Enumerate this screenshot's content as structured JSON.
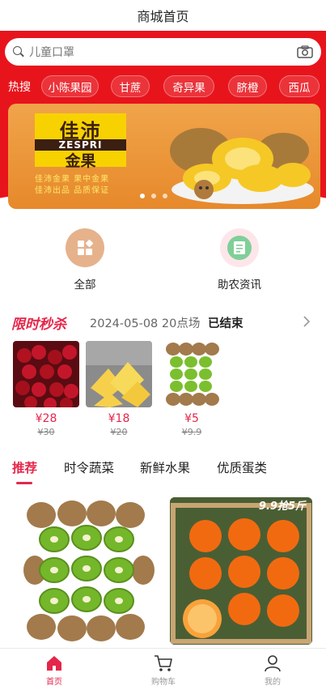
{
  "header": {
    "title": "商城首页"
  },
  "search": {
    "placeholder": "儿童口罩"
  },
  "hot_search": {
    "label": "热搜",
    "tags": [
      "小陈果园",
      "甘蔗",
      "奇异果",
      "脐橙",
      "西瓜"
    ]
  },
  "banner": {
    "logo_line1": "佳沛",
    "logo_line2": "ZESPRI",
    "logo_line3": "金果",
    "caption1": "佳沛金果 果中金果",
    "caption2": "佳沛出品 品质保证"
  },
  "categories": [
    {
      "label": "全部",
      "icon": "grid-icon",
      "color": "#e0a47a"
    },
    {
      "label": "助农资讯",
      "icon": "news-icon",
      "color": "#6cc08a"
    }
  ],
  "flash_sale": {
    "title": "限时秒杀",
    "date": "2024-05-08 20点场",
    "status": "已结束",
    "items": [
      {
        "name": "cherries",
        "price": "¥28",
        "original": "¥30"
      },
      {
        "name": "pineapple",
        "price": "¥18",
        "original": "¥20"
      },
      {
        "name": "kiwi",
        "price": "¥5",
        "original": "¥9.9"
      }
    ]
  },
  "tabs": [
    "推荐",
    "时令蔬菜",
    "新鲜水果",
    "优质蛋类"
  ],
  "products": [
    {
      "name": "kiwi"
    },
    {
      "name": "oranges",
      "tag": "9.9抢5斤"
    }
  ],
  "bottom_nav": [
    {
      "label": "首页",
      "icon": "home-icon",
      "active": true
    },
    {
      "label": "购物车",
      "icon": "cart-icon",
      "active": false
    },
    {
      "label": "我的",
      "icon": "user-icon",
      "active": false
    }
  ],
  "colors": {
    "brand_red": "#e8141c",
    "accent_pink": "#e5264a"
  }
}
